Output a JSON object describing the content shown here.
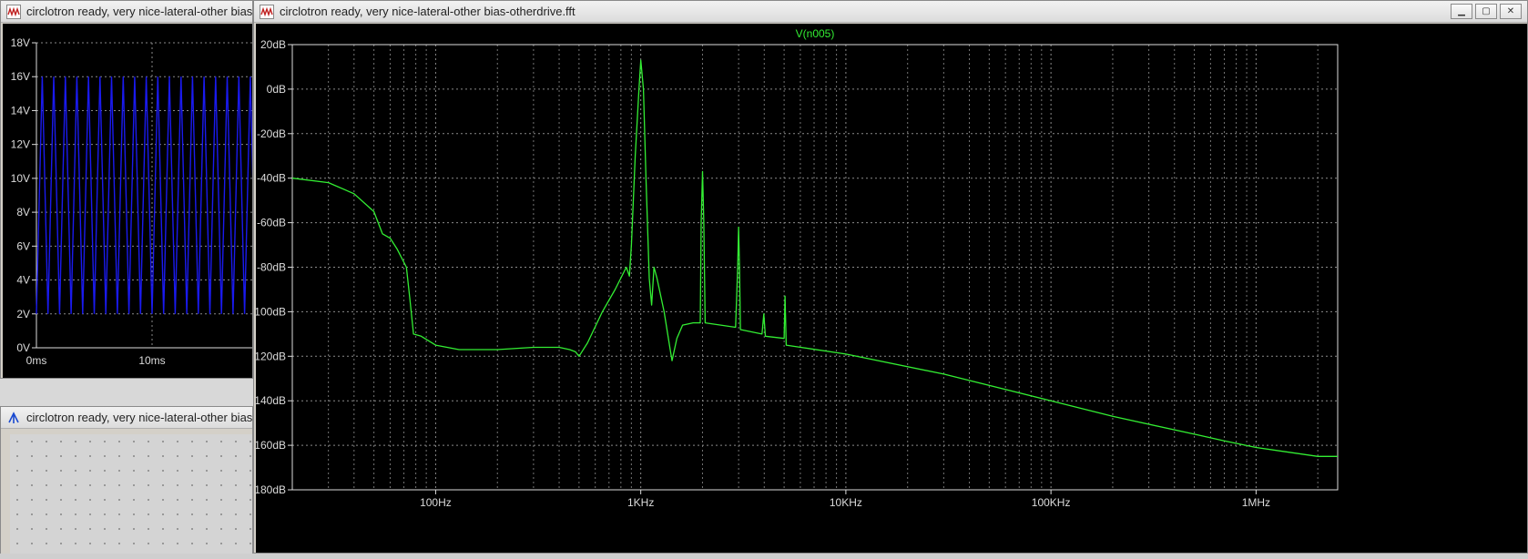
{
  "windows": {
    "transient": {
      "title": "circlotron ready, very nice-lateral-other bias-otherdrive.raw"
    },
    "schematic": {
      "title": "circlotron ready, very nice-lateral-other bias-otherdrive.asc"
    },
    "fft": {
      "title": "circlotron ready, very nice-lateral-other bias-otherdrive.fft",
      "controls": {
        "minimize": "▁",
        "maximize": "▢",
        "close": "✕"
      }
    }
  },
  "colors": {
    "fft_trace": "#33ee33",
    "transient_trace": "#1a1aee",
    "grid": "#8a8a8a",
    "axis_text": "#dcdcdc",
    "trace_label": "#33ee33"
  },
  "transient_chart": {
    "type": "line",
    "ylabel_ticks": [
      "0V",
      "2V",
      "4V",
      "6V",
      "8V",
      "10V",
      "12V",
      "14V",
      "16V",
      "18V"
    ],
    "y_tick_values": [
      0,
      2,
      4,
      6,
      8,
      10,
      12,
      14,
      16,
      18
    ],
    "xlabel_ticks": [
      "0ms",
      "10ms"
    ],
    "x_tick_values": [
      0,
      10
    ],
    "ylim": [
      0,
      18
    ],
    "signal": {
      "min": 2,
      "max": 16,
      "period_ms": 1
    }
  },
  "chart_data": {
    "type": "line",
    "title": "V(n005)",
    "xscale": "log",
    "xlim": [
      20,
      2500000
    ],
    "ylim": [
      -180,
      20
    ],
    "grid": true,
    "x_ticks": [
      {
        "value": 100,
        "label": "100Hz"
      },
      {
        "value": 1000,
        "label": "1KHz"
      },
      {
        "value": 10000,
        "label": "10KHz"
      },
      {
        "value": 100000,
        "label": "100KHz"
      },
      {
        "value": 1000000,
        "label": "1MHz"
      }
    ],
    "y_ticks": [
      {
        "value": 20,
        "label": "20dB"
      },
      {
        "value": 0,
        "label": "0dB"
      },
      {
        "value": -20,
        "label": "-20dB"
      },
      {
        "value": -40,
        "label": "-40dB"
      },
      {
        "value": -60,
        "label": "-60dB"
      },
      {
        "value": -80,
        "label": "-80dB"
      },
      {
        "value": -100,
        "label": "-100dB"
      },
      {
        "value": -120,
        "label": "-120dB"
      },
      {
        "value": -140,
        "label": "-140dB"
      },
      {
        "value": -160,
        "label": "-160dB"
      },
      {
        "value": -180,
        "label": "-180dB"
      }
    ],
    "series": [
      {
        "name": "V(n005)",
        "points": [
          [
            20,
            -40
          ],
          [
            30,
            -42
          ],
          [
            40,
            -47
          ],
          [
            50,
            -55
          ],
          [
            55,
            -65
          ],
          [
            60,
            -67
          ],
          [
            65,
            -72
          ],
          [
            72,
            -80
          ],
          [
            75,
            -95
          ],
          [
            78,
            -110
          ],
          [
            85,
            -111
          ],
          [
            100,
            -115
          ],
          [
            130,
            -117
          ],
          [
            200,
            -117
          ],
          [
            300,
            -116
          ],
          [
            400,
            -116
          ],
          [
            450,
            -117
          ],
          [
            480,
            -118
          ],
          [
            500,
            -120
          ],
          [
            550,
            -114
          ],
          [
            650,
            -100
          ],
          [
            750,
            -90
          ],
          [
            850,
            -80
          ],
          [
            880,
            -84
          ],
          [
            900,
            -70
          ],
          [
            940,
            -30
          ],
          [
            980,
            0
          ],
          [
            1000,
            13
          ],
          [
            1030,
            0
          ],
          [
            1060,
            -40
          ],
          [
            1100,
            -85
          ],
          [
            1130,
            -97
          ],
          [
            1160,
            -80
          ],
          [
            1200,
            -85
          ],
          [
            1300,
            -100
          ],
          [
            1380,
            -115
          ],
          [
            1420,
            -122
          ],
          [
            1500,
            -112
          ],
          [
            1600,
            -106
          ],
          [
            1800,
            -105
          ],
          [
            1950,
            -105
          ],
          [
            1970,
            -60
          ],
          [
            2000,
            -37
          ],
          [
            2030,
            -60
          ],
          [
            2060,
            -105
          ],
          [
            2900,
            -107
          ],
          [
            2970,
            -80
          ],
          [
            3000,
            -62
          ],
          [
            3030,
            -80
          ],
          [
            3060,
            -108
          ],
          [
            3900,
            -110
          ],
          [
            3980,
            -101
          ],
          [
            4050,
            -111
          ],
          [
            5000,
            -112
          ],
          [
            5050,
            -93
          ],
          [
            5120,
            -115
          ],
          [
            10000,
            -119
          ],
          [
            30000,
            -128
          ],
          [
            100000,
            -140
          ],
          [
            200000,
            -147
          ],
          [
            500000,
            -155
          ],
          [
            700000,
            -158
          ],
          [
            1000000,
            -161
          ],
          [
            2000000,
            -165
          ],
          [
            2500000,
            -165
          ]
        ]
      }
    ]
  }
}
